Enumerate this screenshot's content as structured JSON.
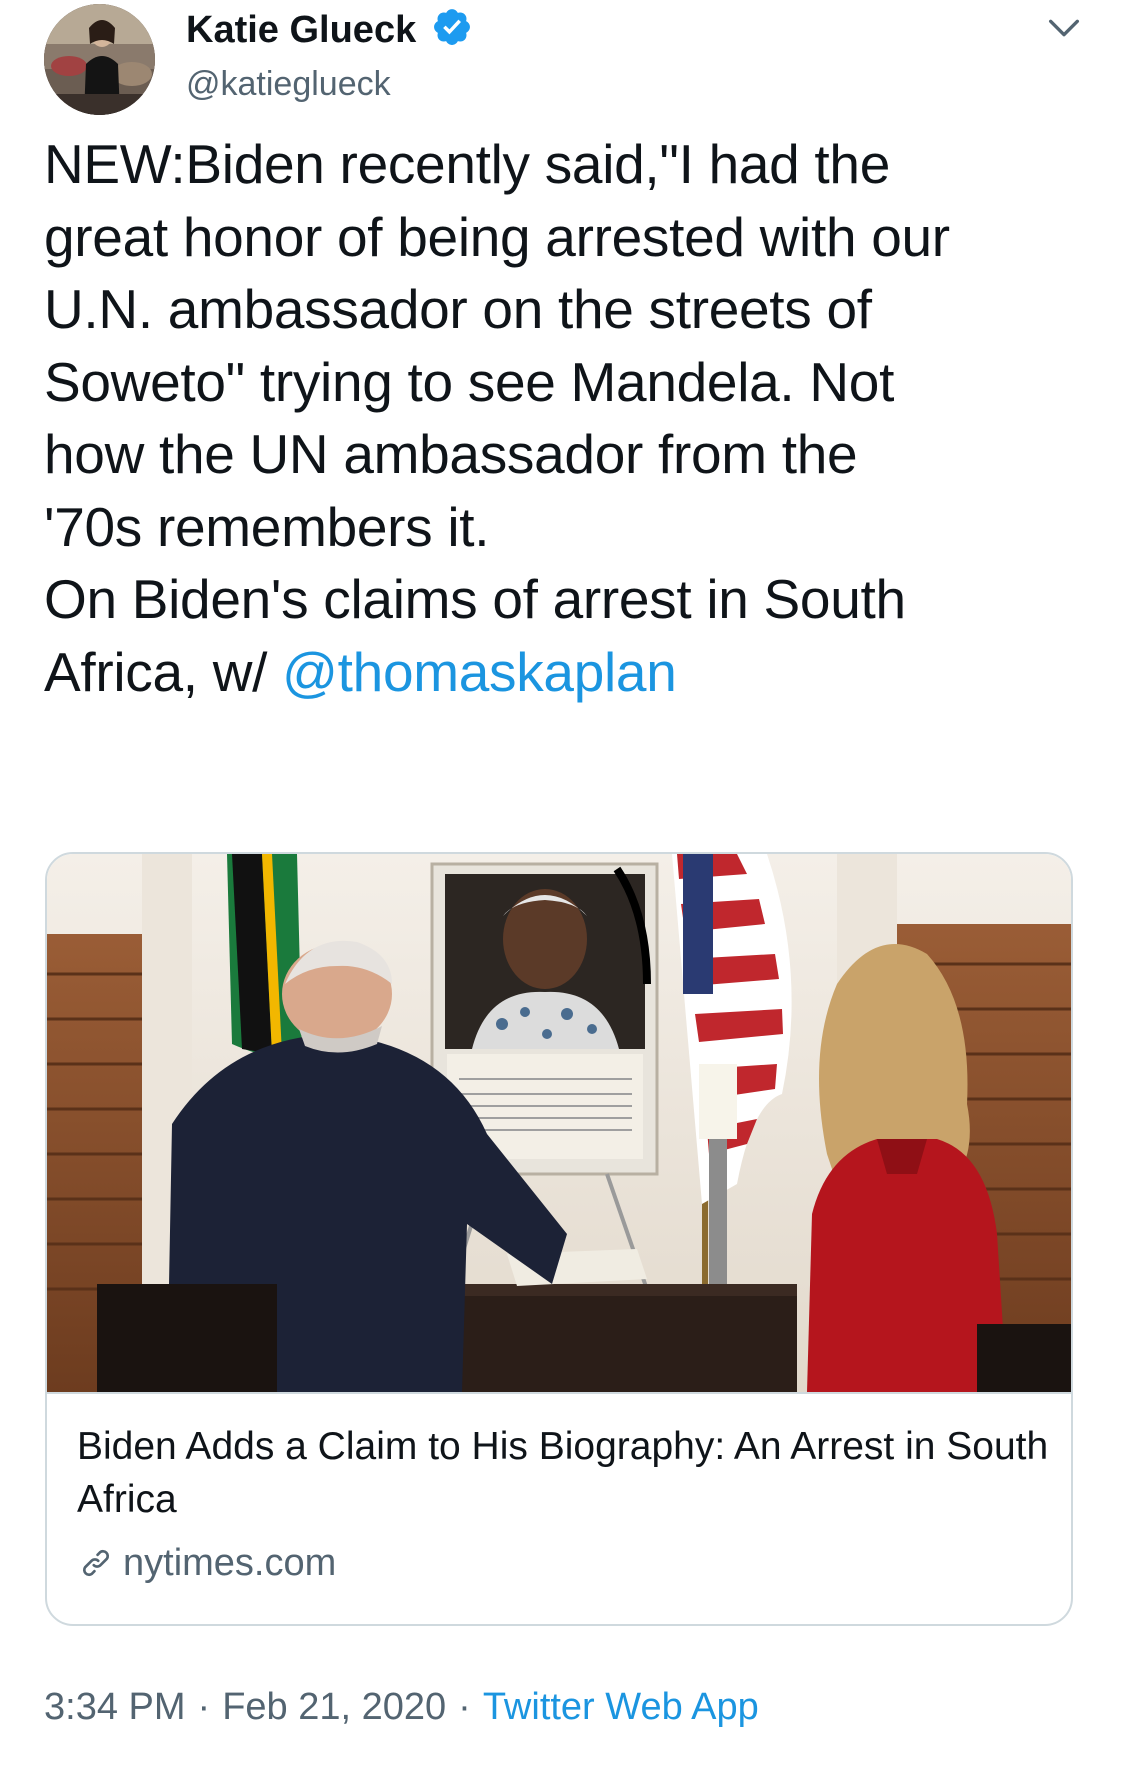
{
  "author": {
    "display_name": "Katie Glueck",
    "handle": "@katieglueck",
    "verified": true
  },
  "tweet": {
    "lines": [
      "NEW:Biden recently said,\"I had the",
      "great honor of being arrested with our",
      "U.N. ambassador on the streets of",
      "Soweto\" trying to see Mandela. Not",
      "how the UN ambassador from the",
      "'70s remembers it.",
      "On Biden's claims of arrest in South"
    ],
    "last_line_prefix": "Africa, w/ ",
    "mention": "@thomaskaplan"
  },
  "card": {
    "title": "Biden Adds a Claim to His Biography: An Arrest in South Africa",
    "domain": "nytimes.com",
    "image_icon": "photo-biden-signing-condolence-book"
  },
  "meta": {
    "time": "3:34 PM",
    "date": "Feb 21, 2020",
    "separator": "·",
    "source": "Twitter Web App"
  },
  "colors": {
    "link": "#1b95e0",
    "verified": "#1d9bf0",
    "secondary_text": "#536471",
    "border": "#cfd9de"
  },
  "icons": {
    "verified": "verified-badge-icon",
    "menu": "chevron-down-icon",
    "link": "link-icon"
  }
}
